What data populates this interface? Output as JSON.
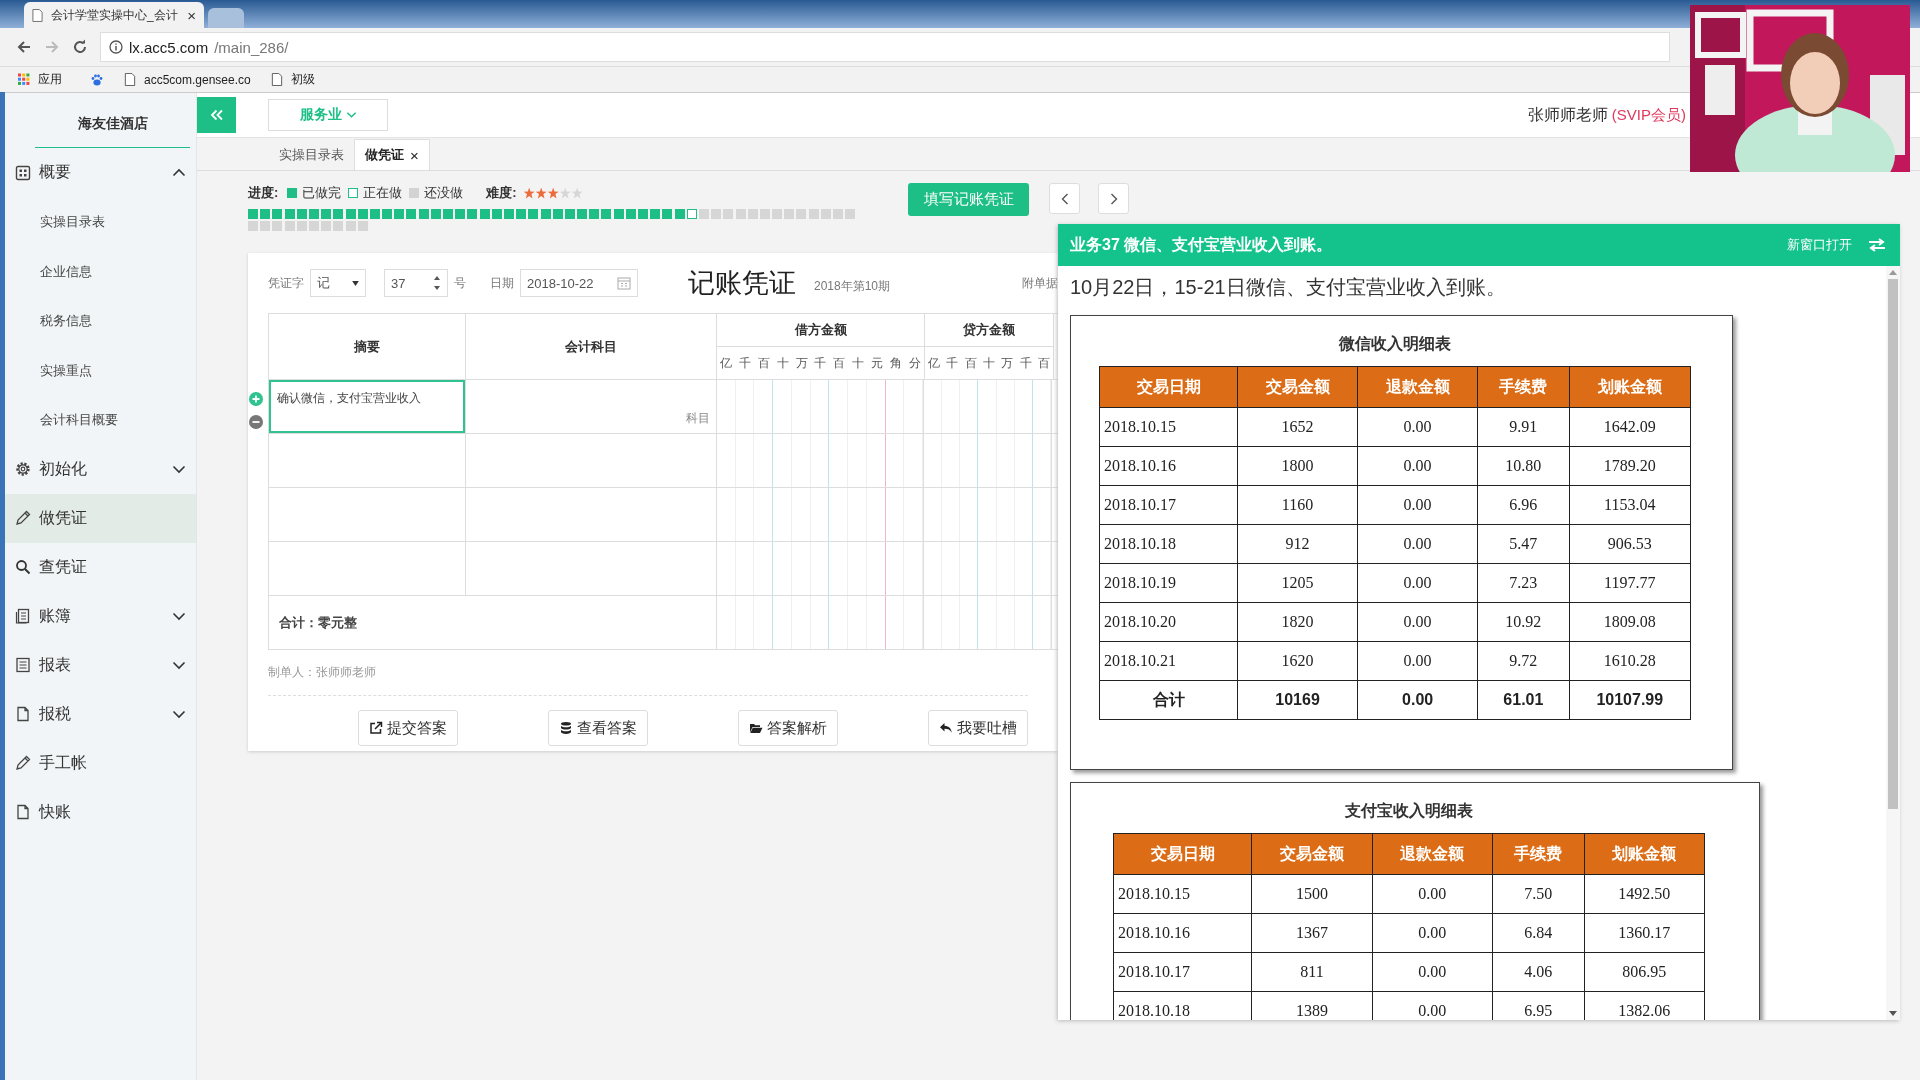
{
  "browser": {
    "tabs": [
      {
        "title": "会计学堂实操中心_会计",
        "close": "×",
        "selected": true
      },
      {
        "selected": false
      }
    ],
    "url_host": "lx.acc5.com",
    "url_path": "/main_286/",
    "bookmarks": [
      {
        "label": "应用"
      },
      {
        "label": "acc5com.gensee.co"
      },
      {
        "label": "初级"
      }
    ]
  },
  "sidebar": {
    "company": "海友佳酒店",
    "items": [
      {
        "label": "概要",
        "expanded": true,
        "selected": false,
        "children": [
          {
            "label": "实操目录表",
            "selected": false
          },
          {
            "label": "企业信息",
            "selected": false
          },
          {
            "label": "税务信息",
            "selected": false
          },
          {
            "label": "实操重点",
            "selected": false
          },
          {
            "label": "会计科目概要",
            "selected": false
          }
        ]
      },
      {
        "label": "初始化",
        "expanded": false,
        "selected": false
      },
      {
        "label": "做凭证",
        "selected": true
      },
      {
        "label": "查凭证",
        "selected": false
      },
      {
        "label": "账簿",
        "expanded": false,
        "selected": false
      },
      {
        "label": "报表",
        "expanded": false,
        "selected": false
      },
      {
        "label": "报税",
        "expanded": false,
        "selected": false
      },
      {
        "label": "手工帐",
        "selected": false
      },
      {
        "label": "快账",
        "selected": false
      }
    ]
  },
  "topbar": {
    "industry": "服务业",
    "user": "张师师老师",
    "badge": "(SVIP会员)"
  },
  "webcam": {
    "kind": "picture"
  },
  "page_tabs": [
    {
      "label": "实操目录表",
      "selected": false
    },
    {
      "label": "做凭证",
      "selected": true,
      "close": "×"
    }
  ],
  "progress": {
    "label": "进度:",
    "legend": [
      {
        "kind": "done",
        "label": "已做完"
      },
      {
        "kind": "current",
        "label": "正在做"
      },
      {
        "kind": "todo",
        "label": "还没做"
      }
    ],
    "difficulty_label": "难度:",
    "stars": 3,
    "steps": [
      {
        "kind": "done"
      },
      {
        "kind": "done"
      },
      {
        "kind": "done"
      },
      {
        "kind": "done"
      },
      {
        "kind": "done"
      },
      {
        "kind": "done"
      },
      {
        "kind": "done"
      },
      {
        "kind": "done"
      },
      {
        "kind": "done"
      },
      {
        "kind": "done"
      },
      {
        "kind": "done"
      },
      {
        "kind": "done"
      },
      {
        "kind": "done"
      },
      {
        "kind": "done"
      },
      {
        "kind": "done"
      },
      {
        "kind": "done"
      },
      {
        "kind": "done"
      },
      {
        "kind": "done"
      },
      {
        "kind": "done"
      },
      {
        "kind": "done"
      },
      {
        "kind": "done"
      },
      {
        "kind": "done"
      },
      {
        "kind": "done"
      },
      {
        "kind": "done"
      },
      {
        "kind": "done"
      },
      {
        "kind": "done"
      },
      {
        "kind": "done"
      },
      {
        "kind": "done"
      },
      {
        "kind": "done"
      },
      {
        "kind": "done"
      },
      {
        "kind": "done"
      },
      {
        "kind": "done"
      },
      {
        "kind": "done"
      },
      {
        "kind": "done"
      },
      {
        "kind": "done"
      },
      {
        "kind": "done"
      },
      {
        "kind": "current"
      },
      {
        "kind": "todo"
      },
      {
        "kind": "todo"
      },
      {
        "kind": "todo"
      },
      {
        "kind": "todo"
      },
      {
        "kind": "todo"
      },
      {
        "kind": "todo"
      },
      {
        "kind": "todo"
      },
      {
        "kind": "todo"
      },
      {
        "kind": "todo"
      },
      {
        "kind": "todo"
      },
      {
        "kind": "todo"
      },
      {
        "kind": "todo"
      },
      {
        "kind": "todo"
      },
      {
        "kind": "todo"
      },
      {
        "kind": "todo"
      },
      {
        "kind": "todo"
      },
      {
        "kind": "todo"
      },
      {
        "kind": "todo"
      },
      {
        "kind": "todo"
      },
      {
        "kind": "todo"
      },
      {
        "kind": "todo"
      },
      {
        "kind": "todo"
      },
      {
        "kind": "todo"
      }
    ]
  },
  "fill_button": "填写记账凭证",
  "voucher": {
    "word_label": "凭证字",
    "word": "记",
    "number": "37",
    "number_suffix": "号",
    "date_label": "日期",
    "date": "2018-10-22",
    "title": "记账凭证",
    "period": "2018年第10期",
    "attachments_label": "附单据",
    "columns": {
      "summary": "摘要",
      "account": "会计科目",
      "debit": "借方金额",
      "credit": "贷方金额"
    },
    "debit_digits": [
      "亿",
      "千",
      "百",
      "十",
      "万",
      "千",
      "百",
      "十",
      "元",
      "角",
      "分"
    ],
    "credit_digits": [
      "亿",
      "千",
      "百",
      "十",
      "万",
      "千",
      "百"
    ],
    "rows": [
      {
        "summary": "确认微信，支付宝营业收入",
        "account_placeholder": "科目",
        "editing": true
      },
      {
        "editing": false
      },
      {
        "editing": false
      },
      {
        "editing": false
      }
    ],
    "total": "合计：零元整",
    "maker": "制单人：张师师老师"
  },
  "actions": [
    "提交答案",
    "查看答案",
    "答案解析",
    "我要吐槽"
  ],
  "panel": {
    "title": "业务37 微信、支付宝营业收入到账。",
    "open_new": "新窗口打开",
    "description": "10月22日，15-21日微信、支付宝营业收入到账。",
    "docs": [
      {
        "title": "微信收入明细表",
        "columns": [
          "交易日期",
          "交易金额",
          "退款金额",
          "手续费",
          "划账金额"
        ],
        "rows": [
          [
            "2018.10.15",
            "1652",
            "0.00",
            "9.91",
            "1642.09"
          ],
          [
            "2018.10.16",
            "1800",
            "0.00",
            "10.80",
            "1789.20"
          ],
          [
            "2018.10.17",
            "1160",
            "0.00",
            "6.96",
            "1153.04"
          ],
          [
            "2018.10.18",
            "912",
            "0.00",
            "5.47",
            "906.53"
          ],
          [
            "2018.10.19",
            "1205",
            "0.00",
            "7.23",
            "1197.77"
          ],
          [
            "2018.10.20",
            "1820",
            "0.00",
            "10.92",
            "1809.08"
          ],
          [
            "2018.10.21",
            "1620",
            "0.00",
            "9.72",
            "1610.28"
          ]
        ],
        "total": [
          "合计",
          "10169",
          "0.00",
          "61.01",
          "10107.99"
        ]
      },
      {
        "title": "支付宝收入明细表",
        "columns": [
          "交易日期",
          "交易金额",
          "退款金额",
          "手续费",
          "划账金额"
        ],
        "rows": [
          [
            "2018.10.15",
            "1500",
            "0.00",
            "7.50",
            "1492.50"
          ],
          [
            "2018.10.16",
            "1367",
            "0.00",
            "6.84",
            "1360.17"
          ],
          [
            "2018.10.17",
            "811",
            "0.00",
            "4.06",
            "806.95"
          ],
          [
            "2018.10.18",
            "1389",
            "0.00",
            "6.95",
            "1382.06"
          ]
        ]
      }
    ]
  }
}
